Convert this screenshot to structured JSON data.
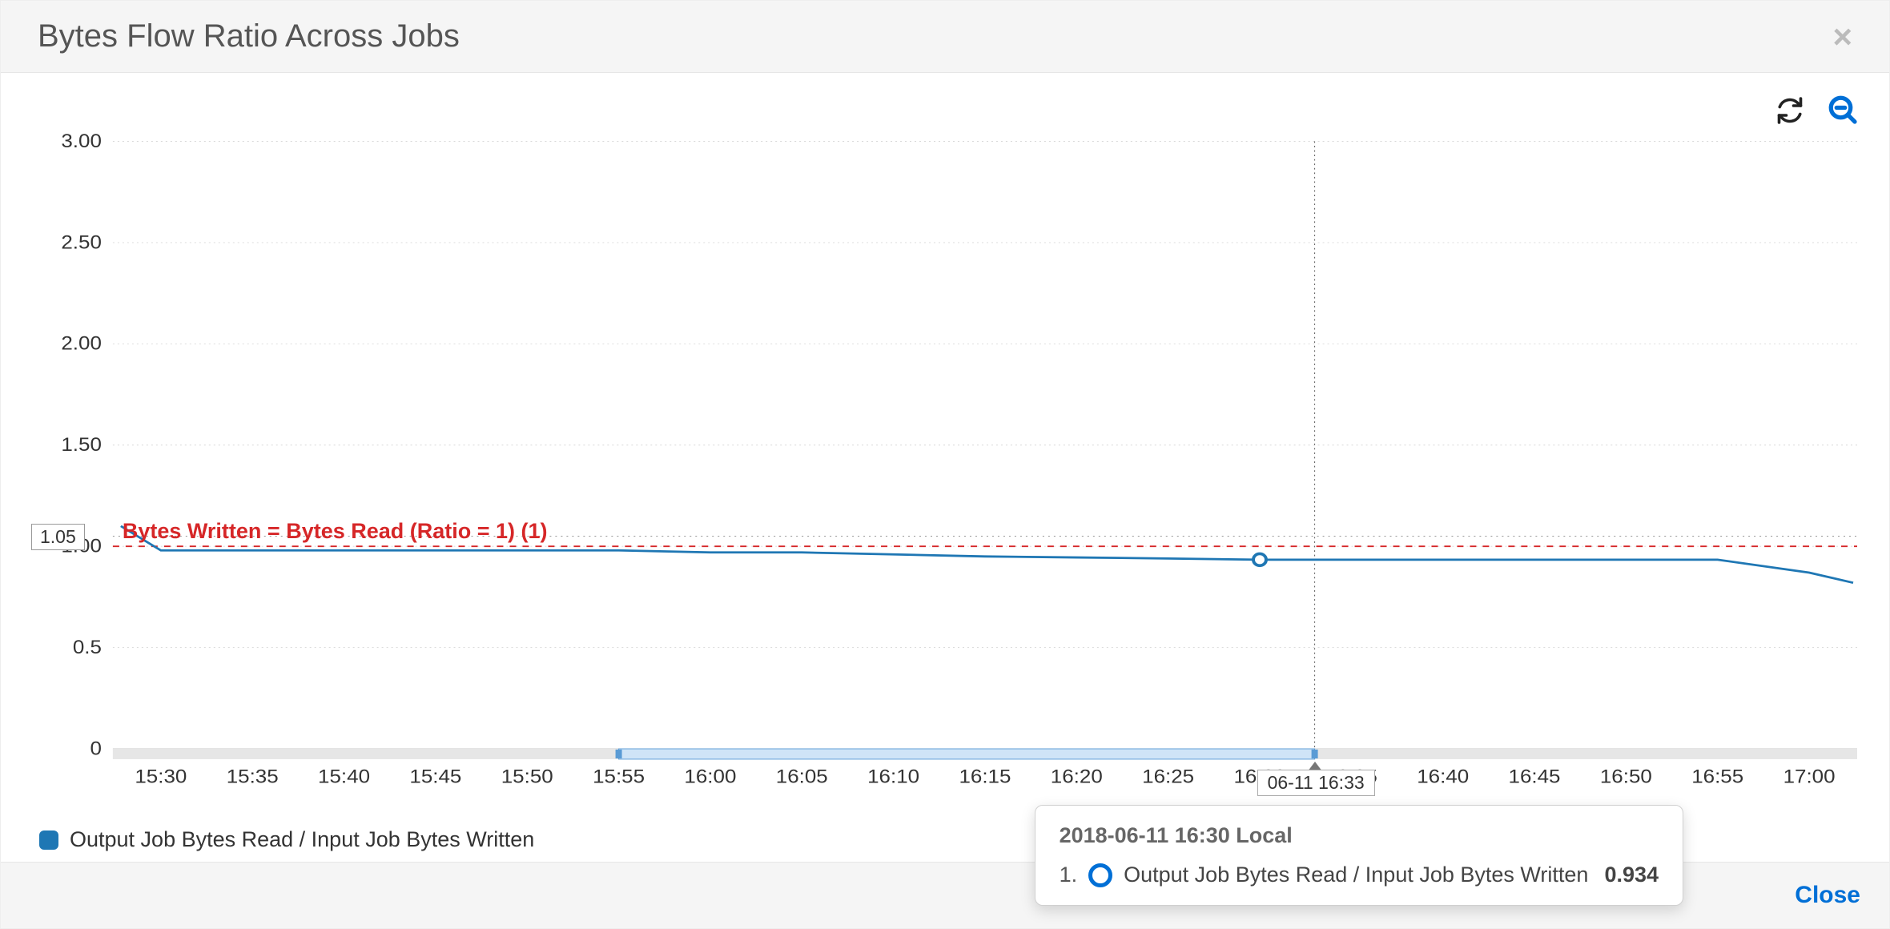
{
  "header": {
    "title": "Bytes Flow Ratio Across Jobs",
    "close_glyph": "×"
  },
  "footer": {
    "close_label": "Close"
  },
  "legend": {
    "series_label": "Output Job Bytes Read / Input Job Bytes Written"
  },
  "threshold": {
    "label": "Bytes Written = Bytes Read (Ratio = 1) (1)",
    "value": 1
  },
  "hover": {
    "y_label": "1.05",
    "x_label": "06-11 16:33",
    "tooltip_title": "2018-06-11 16:30 Local",
    "tooltip_index": "1.",
    "tooltip_series": "Output Job Bytes Read / Input Job Bytes Written",
    "tooltip_value": "0.934",
    "hover_x_category": "16:33"
  },
  "range_selector": {
    "start": "15:55",
    "end": "16:33"
  },
  "chart_data": {
    "type": "line",
    "title": "Bytes Flow Ratio Across Jobs",
    "xlabel": "",
    "ylabel": "",
    "ylim": [
      0,
      3.0
    ],
    "y_ticks": [
      0,
      0.5,
      1.0,
      1.5,
      2.0,
      2.5,
      3.0
    ],
    "y_tick_labels": [
      "0",
      "0.5",
      "1.00",
      "1.50",
      "2.00",
      "2.50",
      "3.00"
    ],
    "categories": [
      "15:30",
      "15:35",
      "15:40",
      "15:45",
      "15:50",
      "15:55",
      "16:00",
      "16:05",
      "16:10",
      "16:15",
      "16:20",
      "16:25",
      "16:30",
      "16:35",
      "16:40",
      "16:45",
      "16:50",
      "16:55",
      "17:00"
    ],
    "series": [
      {
        "name": "Output Job Bytes Read / Input Job Bytes Written",
        "color": "#1f77b4",
        "values_before_first_tick": 1.1,
        "values": [
          0.98,
          0.98,
          0.98,
          0.98,
          0.98,
          0.98,
          0.97,
          0.97,
          0.96,
          0.95,
          0.945,
          0.94,
          0.934,
          0.934,
          0.934,
          0.934,
          0.934,
          0.934,
          0.87
        ],
        "value_after_last_tick": 0.82
      }
    ],
    "reference_lines": [
      {
        "label": "Bytes Written = Bytes Read (Ratio = 1) (1)",
        "y": 1,
        "color": "#d62728",
        "style": "dashed"
      }
    ],
    "hover_point": {
      "x": "16:30",
      "y": 0.934
    }
  }
}
